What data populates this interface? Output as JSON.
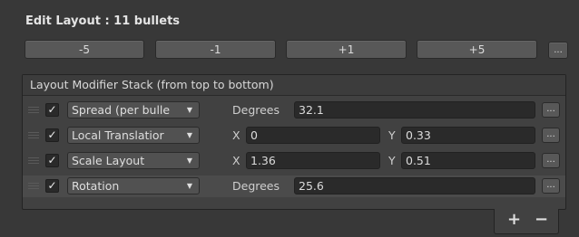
{
  "title": "Edit Layout : 11 bullets",
  "step_buttons": [
    "-5",
    "-1",
    "+1",
    "+5"
  ],
  "more_label": "...",
  "stack": {
    "header": "Layout Modifier Stack (from top to bottom)",
    "rows": [
      {
        "enabled_mark": "✓",
        "modifier": "Spread (per bulle",
        "fields": [
          {
            "label": "Degrees",
            "value": "32.1"
          }
        ]
      },
      {
        "enabled_mark": "✓",
        "modifier": "Local Translatior",
        "fields": [
          {
            "label": "X",
            "value": "0"
          },
          {
            "label": "Y",
            "value": "0.33"
          }
        ]
      },
      {
        "enabled_mark": "✓",
        "modifier": "Scale Layout",
        "fields": [
          {
            "label": "X",
            "value": "1.36"
          },
          {
            "label": "Y",
            "value": "0.51"
          }
        ]
      },
      {
        "enabled_mark": "✓",
        "modifier": "Rotation",
        "fields": [
          {
            "label": "Degrees",
            "value": "25.6"
          }
        ]
      }
    ]
  },
  "footer": {
    "add": "+",
    "remove": "−"
  },
  "icons": {
    "dropdown": "dropdown-arrow-icon",
    "check": "checkmark-icon",
    "handle": "drag-handle-icon"
  },
  "colors": {
    "background": "#383838",
    "field": "#2a2a2a",
    "button": "#585858"
  }
}
